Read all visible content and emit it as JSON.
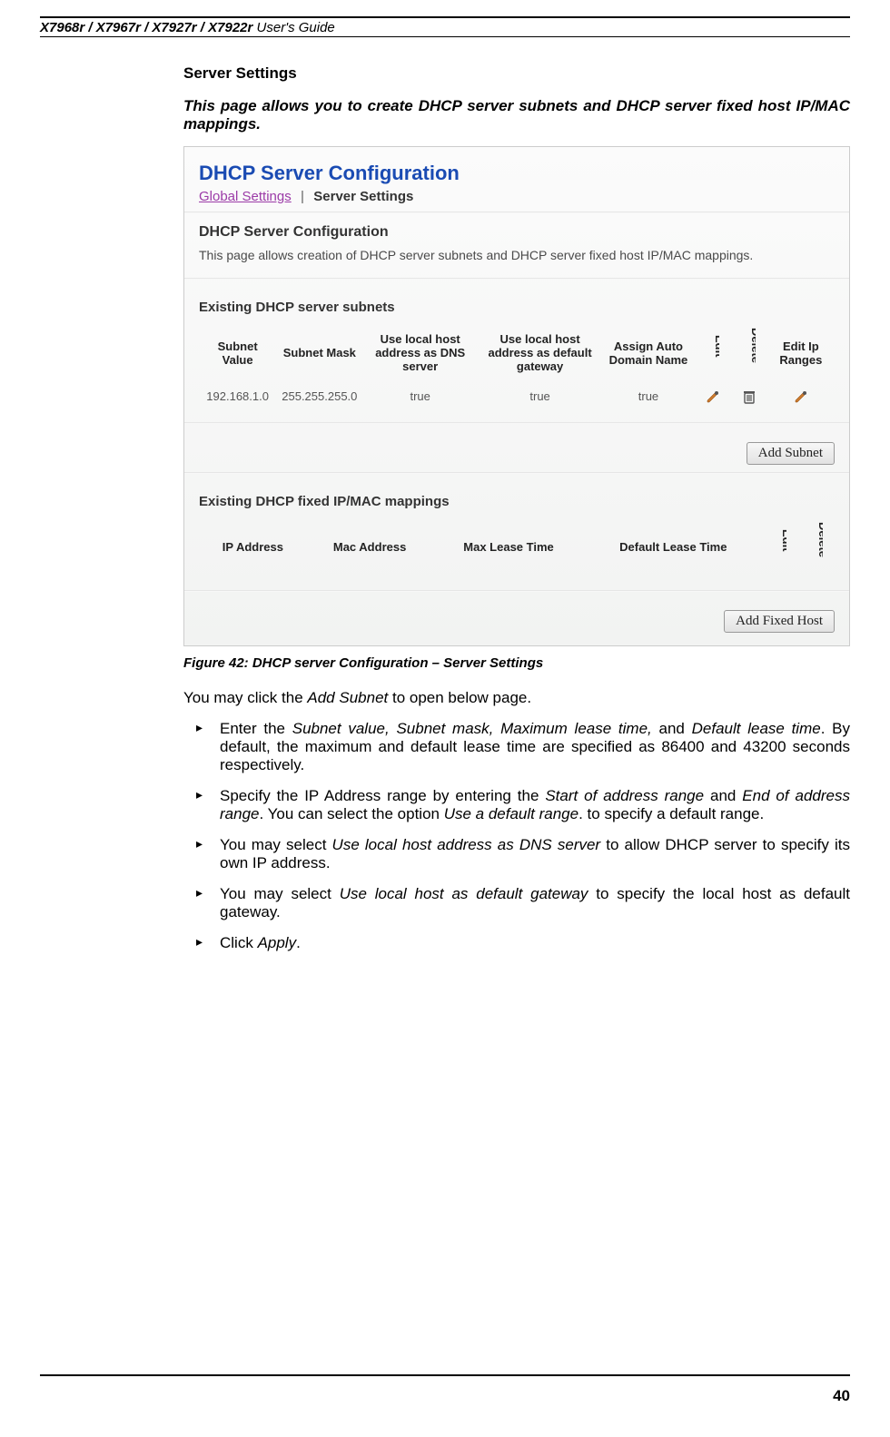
{
  "header": {
    "models": "X7968r / X7967r / X7927r / X7922r",
    "suffix": "User's Guide"
  },
  "section_title": "Server Settings",
  "intro": "This page allows you to create DHCP server subnets and DHCP server fixed host IP/MAC mappings.",
  "screenshot": {
    "title": "DHCP Server Configuration",
    "tab_link": "Global Settings",
    "tab_active": "Server Settings",
    "heading": "DHCP Server Configuration",
    "desc": "This page allows creation of DHCP server subnets and DHCP server fixed host IP/MAC mappings.",
    "subnets_title": "Existing DHCP server subnets",
    "subnets_headers": {
      "subnet_value": "Subnet Value",
      "subnet_mask": "Subnet Mask",
      "use_local_dns": "Use local host address as DNS server",
      "use_local_gw": "Use local host address as default gateway",
      "assign_auto": "Assign Auto Domain Name",
      "edit": "Edit",
      "delete": "Delete",
      "edit_ip": "Edit Ip Ranges"
    },
    "subnets_row": {
      "subnet_value": "192.168.1.0",
      "subnet_mask": "255.255.255.0",
      "use_local_dns": "true",
      "use_local_gw": "true",
      "assign_auto": "true"
    },
    "add_subnet_btn": "Add Subnet",
    "fixed_title": "Existing DHCP fixed IP/MAC mappings",
    "fixed_headers": {
      "ip": "IP Address",
      "mac": "Mac Address",
      "max_lease": "Max Lease Time",
      "default_lease": "Default Lease Time",
      "edit": "Edit",
      "delete": "Delete"
    },
    "add_fixed_btn": "Add Fixed Host"
  },
  "caption": "Figure 42: DHCP server Configuration – Server Settings",
  "para_intro_pre": "You may click the ",
  "para_intro_em": "Add Subnet",
  "para_intro_post": " to open below page.",
  "bullets": {
    "b1": {
      "pre": "Enter the ",
      "em": "Subnet value, Subnet mask, Maximum lease time,",
      "mid": " and ",
      "em2": "Default lease time",
      "post": ". By default, the maximum and default lease time are specified as 86400 and 43200 seconds respectively."
    },
    "b2": {
      "pre": "Specify the IP Address range by entering the ",
      "em": "Start of address range",
      "mid": " and ",
      "em2": "End of address range",
      "post": ". You can select the option ",
      "em3": "Use a default range",
      "post2": ". to specify a default range."
    },
    "b3": {
      "pre": "You may select ",
      "em": "Use local host address as DNS server",
      "post": " to allow DHCP server to specify its own IP address."
    },
    "b4": {
      "pre": "You may select ",
      "em": "Use local host as default gateway",
      "post": " to specify the local host as default gateway."
    },
    "b5": {
      "pre": "Click ",
      "em": "Apply",
      "post": "."
    }
  },
  "page_number": "40"
}
